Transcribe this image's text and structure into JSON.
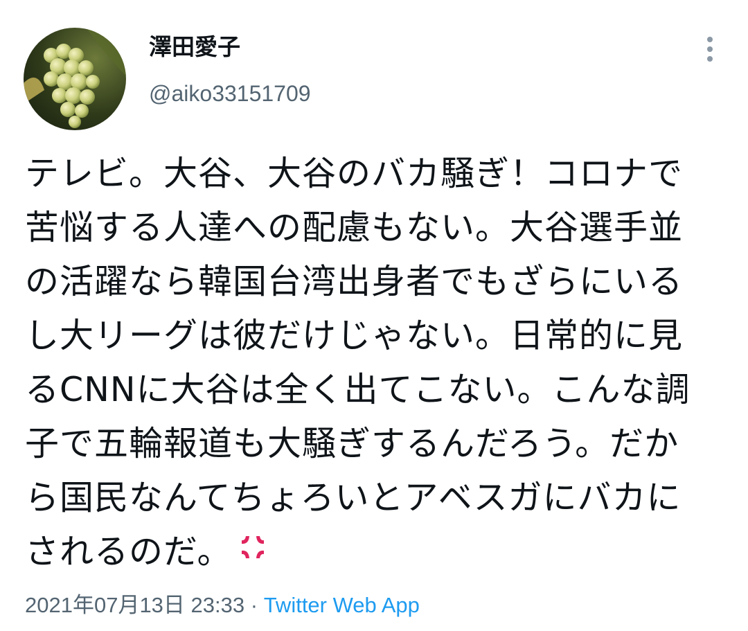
{
  "tweet": {
    "display_name": "澤田愛子",
    "handle": "@aiko33151709",
    "text_lines": [
      "テレビ。大谷、大谷のバカ騒ぎ！コロナで",
      "苦悩する人達への配慮もない。大谷選手並",
      "の活躍なら韓国台湾出身者でもざらにいる",
      "し大リーグは彼だけじゃない。日常的に見",
      "るCNNに大谷は全く出てこない。こんな調",
      "子で五輪報道も大騒ぎするんだろう。だか",
      "ら国民なんてちょろいとアベスガにバカに",
      "されるのだ。"
    ],
    "emoji": "anger-symbol-icon",
    "timestamp": "2021年07月13日 23:33",
    "separator": "·",
    "source": "Twitter Web App"
  },
  "colors": {
    "text": "#0f1419",
    "secondary": "#536471",
    "link": "#1d9bf0",
    "anger": "#e0245e"
  }
}
